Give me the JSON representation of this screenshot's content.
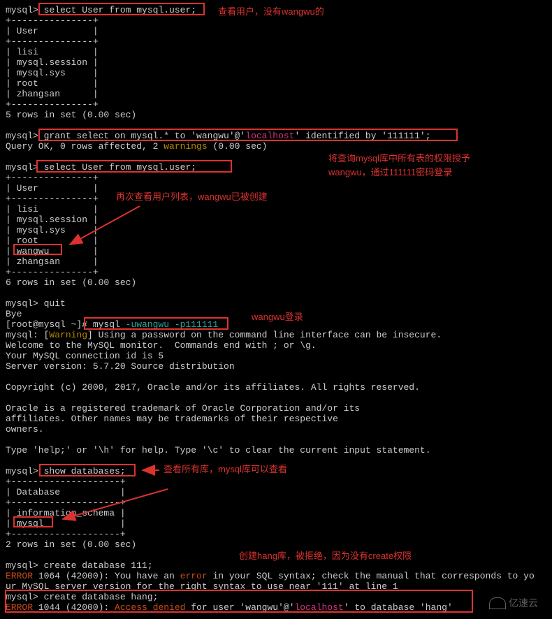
{
  "terminal": {
    "prompt_mysql": "mysql>",
    "prompt_root": "[root@mysql ~]#",
    "cmd_select1": " select User from mysql.user;",
    "border_top": "+---------------+",
    "col_user": "| User          |",
    "row_lisi": "| lisi          |",
    "row_session": "| mysql.session |",
    "row_sys": "| mysql.sys     |",
    "row_root": "| root          |",
    "row_zhang": "| zhangsan      |",
    "row_wangwu": "| wangwu        |",
    "rows5": "5 rows in set (0.00 sec)",
    "blank": " ",
    "grant_pre": " grant select on mysql.* to 'wangwu'@'",
    "grant_host": "localhost",
    "grant_post": "' identified by '111111';",
    "query_ok_pre": "Query OK, 0 rows affected, 2 ",
    "query_ok_warn": "warnings",
    "query_ok_post": " (0.00 sec)",
    "cmd_select2": " select User from mysql.user;",
    "rows6": "6 rows in set (0.00 sec)",
    "quit": " quit",
    "bye": "Bye",
    "login_cmd_pre": " mysql ",
    "login_user": "-uwangwu",
    "login_pass": " -p111111",
    "warn_line_pre": "mysql: [",
    "warn_word": "Warning",
    "warn_line_post": "] Using a password on the command line interface can be insecure.",
    "welcome1": "Welcome to the MySQL monitor.  Commands end with ; or \\g.",
    "welcome2": "Your MySQL connection id is 5",
    "welcome3": "Server version: 5.7.20 Source distribution",
    "copyright": "Copyright (c) 2000, 2017, Oracle and/or its affiliates. All rights reserved.",
    "oracle1": "Oracle is a registered trademark of Oracle Corporation and/or its",
    "oracle2": "affiliates. Other names may be trademarks of their respective",
    "oracle3": "owners.",
    "help": "Type 'help;' or '\\h' for help. Type '\\c' to clear the current input statement.",
    "showdb": " show databases;",
    "db_border": "+--------------------+",
    "db_col": "| Database           |",
    "db_infosch": "| information_schema |",
    "db_mysql": "| mysql              |",
    "rows2": "2 rows in set (0.00 sec)",
    "create111": " create database 111;",
    "err1064_pre": "ERROR",
    "err1064_mid": " 1064 (42000): You have an ",
    "err1064_word": "error",
    "err1064_post": " in your SQL syntax; check the manual that corresponds to yo",
    "err1064_line2": "ur MySQL server version for the right syntax to use near '111' at line 1",
    "createhang": " create database hang;",
    "err1044_pre": "ERROR",
    "err1044_mid": " 1044 (42000): ",
    "err1044_ad": "Access denied",
    "err1044_post_a": " for user 'wangwu'@'",
    "err1044_host": "localhost",
    "err1044_post_b": "' to database 'hang'"
  },
  "annotations": {
    "n1": "查看用户，没有wangwu的",
    "n2": "将查询mysql库中所有表的权限授予",
    "n2b": "wangwu，通过111111密码登录",
    "n3": "再次查看用户列表，wangwu已被创建",
    "n4": "wangwu登录",
    "n5": "查看所有库，mysql库可以查看",
    "n6": "创建hang库，被拒绝，因为没有create权限"
  },
  "watermark": "亿速云"
}
